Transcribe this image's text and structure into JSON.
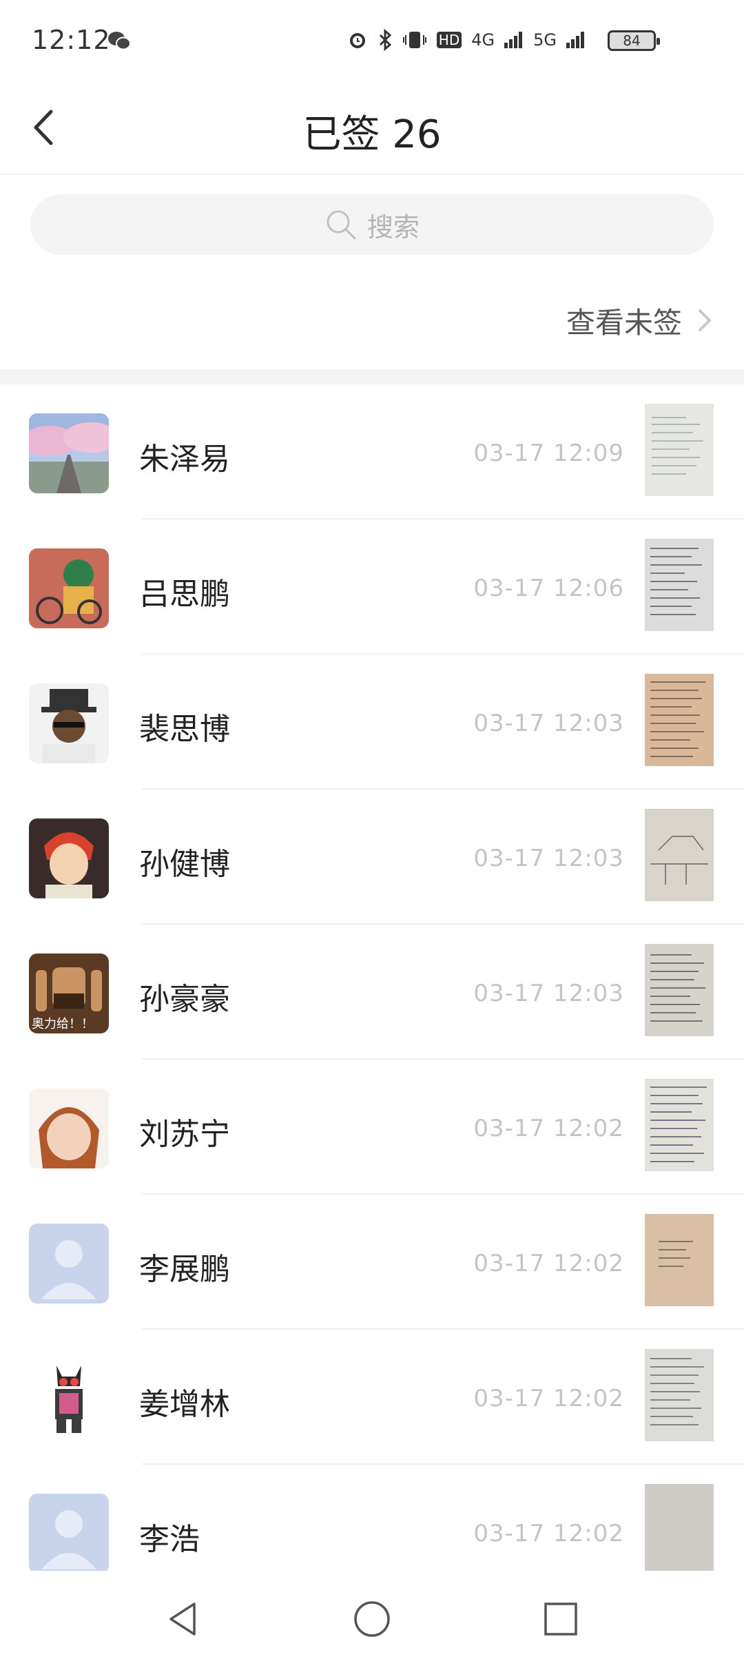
{
  "status_bar": {
    "time": "12:12",
    "network_4g": "4G",
    "network_5g": "5G",
    "hd": "HD",
    "battery": "84"
  },
  "header": {
    "title": "已签 26"
  },
  "search": {
    "placeholder": "搜索"
  },
  "unsigned_link": {
    "label": "查看未签"
  },
  "list": [
    {
      "name": "朱泽易",
      "time": "03-17 12:09",
      "avatar": "cherry-blossom-avatar"
    },
    {
      "name": "吕思鹏",
      "time": "03-17 12:06",
      "avatar": "cartoon-rider-avatar"
    },
    {
      "name": "裴思博",
      "time": "03-17 12:03",
      "avatar": "top-hat-man-avatar"
    },
    {
      "name": "孙健博",
      "time": "03-17 12:03",
      "avatar": "anime-redhead-avatar"
    },
    {
      "name": "孙豪豪",
      "time": "03-17 12:03",
      "avatar": "cartoon-bearded-avatar",
      "avatar_text": "奥力给！！"
    },
    {
      "name": "刘苏宁",
      "time": "03-17 12:02",
      "avatar": "baby-hood-avatar"
    },
    {
      "name": "李展鹏",
      "time": "03-17 12:02",
      "avatar": "default-person-avatar"
    },
    {
      "name": "姜增林",
      "time": "03-17 12:02",
      "avatar": "masked-hero-avatar"
    },
    {
      "name": "李浩",
      "time": "03-17 12:02",
      "avatar": "default-person-avatar"
    }
  ],
  "colors": {
    "time_text": "#c4c4c4",
    "default_avatar_bg": "#c9d3ec",
    "search_bg": "#f4f4f4"
  }
}
